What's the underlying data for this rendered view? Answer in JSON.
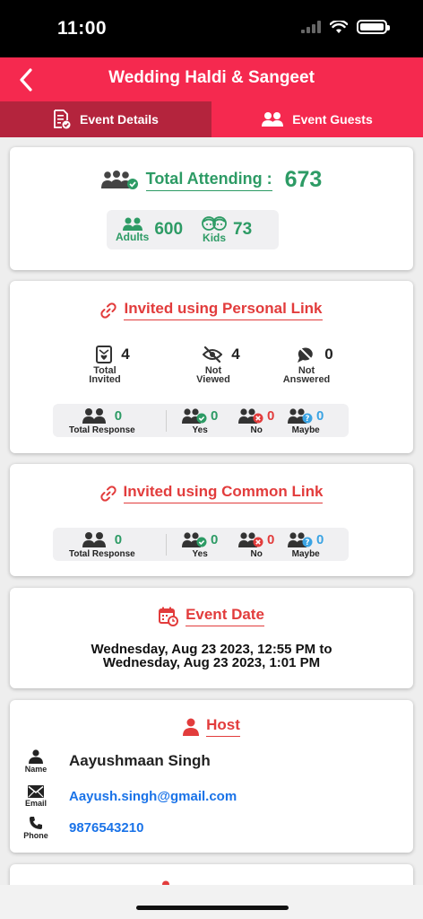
{
  "status": {
    "time": "11:00"
  },
  "header": {
    "title": "Wedding Haldi & Sangeet"
  },
  "tabs": [
    {
      "label": "Event Details"
    },
    {
      "label": "Event Guests"
    }
  ],
  "attending": {
    "title": "Total Attending :",
    "total": "673",
    "adults_label": "Adults",
    "adults": "600",
    "kids_label": "Kids",
    "kids": "73"
  },
  "personal_link": {
    "title": "Invited using Personal Link",
    "stats": [
      {
        "num": "4",
        "label1": "Total",
        "label2": "Invited"
      },
      {
        "num": "4",
        "label1": "Not",
        "label2": "Viewed"
      },
      {
        "num": "0",
        "label1": "Not",
        "label2": "Answered"
      }
    ],
    "responses": [
      {
        "num": "0",
        "label": "Total Response"
      },
      {
        "num": "0",
        "label": "Yes"
      },
      {
        "num": "0",
        "label": "No"
      },
      {
        "num": "0",
        "label": "Maybe"
      }
    ]
  },
  "common_link": {
    "title": "Invited using Common Link",
    "responses": [
      {
        "num": "0",
        "label": "Total Response"
      },
      {
        "num": "0",
        "label": "Yes"
      },
      {
        "num": "0",
        "label": "No"
      },
      {
        "num": "0",
        "label": "Maybe"
      }
    ]
  },
  "event_date": {
    "title": "Event Date",
    "line1": "Wednesday, Aug 23 2023, 12:55 PM to",
    "line2": "Wednesday, Aug 23 2023, 1:01 PM"
  },
  "host": {
    "title": "Host",
    "name_label": "Name",
    "name": "Aayushmaan Singh",
    "email_label": "Email",
    "email": "Aayush.singh@gmail.com",
    "phone_label": "Phone",
    "phone": "9876543210"
  },
  "colors": {
    "brand": "#f5294f",
    "brand_dark": "#b4243d",
    "green": "#2d9b65",
    "red_title": "#e23c3c",
    "link": "#1a73e8"
  }
}
